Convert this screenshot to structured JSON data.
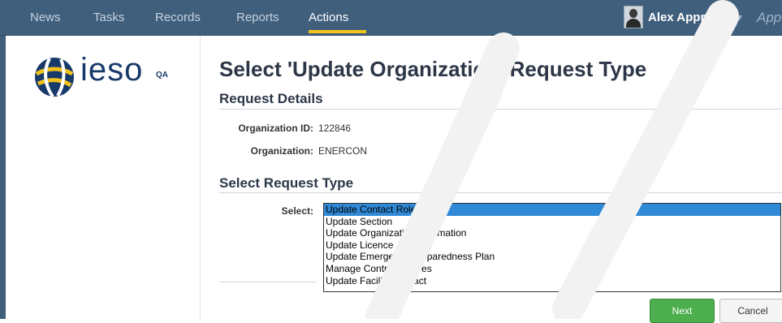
{
  "nav": {
    "items": [
      {
        "label": "News"
      },
      {
        "label": "Tasks"
      },
      {
        "label": "Records"
      },
      {
        "label": "Reports"
      },
      {
        "label": "Actions"
      }
    ],
    "active": "Actions",
    "user_name": "Alex Apprep",
    "user_caret": "▾",
    "app_label": "App"
  },
  "sidebar": {
    "logo_text": "ieso",
    "env_badge": "QA"
  },
  "page": {
    "title": "Select 'Update Organization' Request Type",
    "request_details": {
      "heading": "Request Details",
      "org_id_label": "Organization ID:",
      "org_id_value": "122846",
      "org_label": "Organization:",
      "org_value": "ENERCON"
    },
    "select_request": {
      "heading": "Select Request Type",
      "select_label": "Select:",
      "options": [
        "Update Contact Role(s)",
        "Update Section",
        "Update Organization Information",
        "Update Licence",
        "Update Emergency Preparedness Plan",
        "Manage Control Centres",
        "Update Facility Contact"
      ],
      "selected_index": 0
    },
    "buttons": {
      "next": "Next",
      "cancel": "Cancel"
    }
  },
  "colors": {
    "nav_bg": "#3f5f7d",
    "nav_active_underline": "#f2c21a",
    "selected_option": "#2f89d6",
    "next_button": "#4cae4c",
    "logo": "#173a6b"
  }
}
